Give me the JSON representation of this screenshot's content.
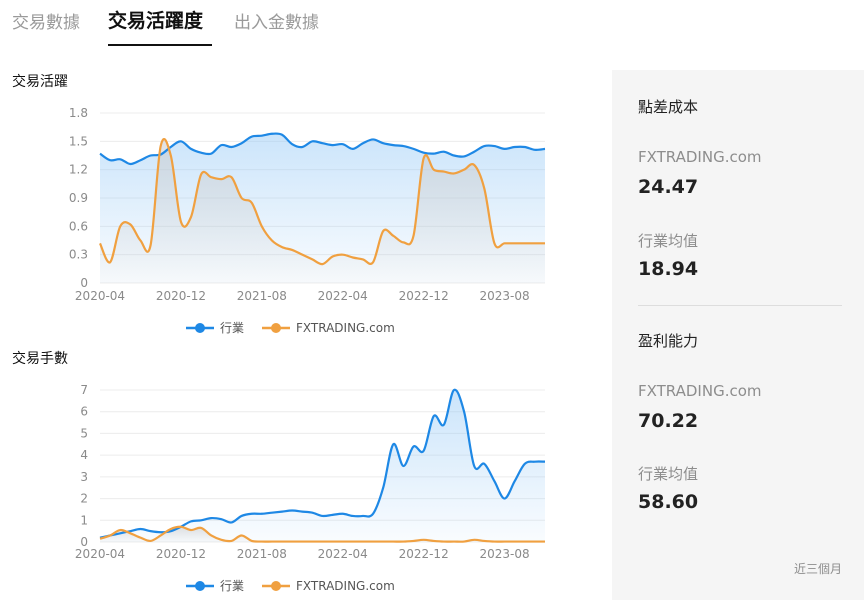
{
  "tabs": [
    {
      "label": "交易數據",
      "active": false
    },
    {
      "label": "交易活躍度",
      "active": true
    },
    {
      "label": "出入金數據",
      "active": false
    }
  ],
  "charts": {
    "activity": {
      "title": "交易活躍"
    },
    "volume": {
      "title": "交易手數"
    }
  },
  "chart_data": [
    {
      "type": "area",
      "title": "交易活躍",
      "xlabel": "",
      "ylabel": "",
      "ylim": [
        0,
        1.8
      ],
      "yticks": [
        "0",
        "0.3",
        "0.6",
        "0.9",
        "1.2",
        "1.5",
        "1.8"
      ],
      "xticks": [
        "2020-04",
        "2020-12",
        "2021-08",
        "2022-04",
        "2022-12",
        "2023-08"
      ],
      "legend": "bottom",
      "grid": true,
      "x": [
        "2020-04",
        "2020-05",
        "2020-06",
        "2020-07",
        "2020-08",
        "2020-09",
        "2020-10",
        "2020-11",
        "2020-12",
        "2021-01",
        "2021-02",
        "2021-03",
        "2021-04",
        "2021-05",
        "2021-06",
        "2021-07",
        "2021-08",
        "2021-09",
        "2021-10",
        "2021-11",
        "2021-12",
        "2022-01",
        "2022-02",
        "2022-03",
        "2022-04",
        "2022-05",
        "2022-06",
        "2022-07",
        "2022-08",
        "2022-09",
        "2022-10",
        "2022-11",
        "2022-12",
        "2023-01",
        "2023-02",
        "2023-03",
        "2023-04",
        "2023-05",
        "2023-06",
        "2023-07",
        "2023-08",
        "2023-09",
        "2023-10",
        "2023-11",
        "2023-12"
      ],
      "series": [
        {
          "name": "行業",
          "color": "#1e88e5",
          "values": [
            1.37,
            1.3,
            1.31,
            1.26,
            1.3,
            1.35,
            1.36,
            1.44,
            1.5,
            1.42,
            1.38,
            1.37,
            1.46,
            1.44,
            1.48,
            1.55,
            1.56,
            1.58,
            1.57,
            1.47,
            1.44,
            1.5,
            1.48,
            1.46,
            1.47,
            1.42,
            1.48,
            1.52,
            1.48,
            1.46,
            1.45,
            1.42,
            1.38,
            1.37,
            1.39,
            1.35,
            1.34,
            1.39,
            1.45,
            1.45,
            1.42,
            1.44,
            1.44,
            1.41,
            1.42
          ]
        },
        {
          "name": "FXTRADING.com",
          "color": "#f0a040",
          "values": [
            0.42,
            0.22,
            0.6,
            0.62,
            0.45,
            0.4,
            1.45,
            1.35,
            0.65,
            0.7,
            1.15,
            1.12,
            1.1,
            1.12,
            0.9,
            0.85,
            0.6,
            0.45,
            0.38,
            0.35,
            0.3,
            0.25,
            0.2,
            0.28,
            0.3,
            0.27,
            0.25,
            0.22,
            0.55,
            0.5,
            0.43,
            0.5,
            1.32,
            1.2,
            1.18,
            1.16,
            1.2,
            1.25,
            1.0,
            0.42,
            0.42,
            0.42,
            0.42,
            0.42,
            0.42
          ]
        }
      ]
    },
    {
      "type": "area",
      "title": "交易手數",
      "xlabel": "",
      "ylabel": "",
      "ylim": [
        0,
        7
      ],
      "yticks": [
        "0",
        "1",
        "2",
        "3",
        "4",
        "5",
        "6",
        "7"
      ],
      "xticks": [
        "2020-04",
        "2020-12",
        "2021-08",
        "2022-04",
        "2022-12",
        "2023-08"
      ],
      "legend": "bottom",
      "grid": true,
      "x": [
        "2020-04",
        "2020-05",
        "2020-06",
        "2020-07",
        "2020-08",
        "2020-09",
        "2020-10",
        "2020-11",
        "2020-12",
        "2021-01",
        "2021-02",
        "2021-03",
        "2021-04",
        "2021-05",
        "2021-06",
        "2021-07",
        "2021-08",
        "2021-09",
        "2021-10",
        "2021-11",
        "2021-12",
        "2022-01",
        "2022-02",
        "2022-03",
        "2022-04",
        "2022-05",
        "2022-06",
        "2022-07",
        "2022-08",
        "2022-09",
        "2022-10",
        "2022-11",
        "2022-12",
        "2023-01",
        "2023-02",
        "2023-03",
        "2023-04",
        "2023-05",
        "2023-06",
        "2023-07",
        "2023-08",
        "2023-09",
        "2023-10",
        "2023-11",
        "2023-12"
      ],
      "series": [
        {
          "name": "行業",
          "color": "#1e88e5",
          "values": [
            0.2,
            0.3,
            0.4,
            0.5,
            0.6,
            0.5,
            0.45,
            0.5,
            0.7,
            0.95,
            1.0,
            1.1,
            1.05,
            0.9,
            1.2,
            1.3,
            1.3,
            1.35,
            1.4,
            1.45,
            1.4,
            1.35,
            1.2,
            1.25,
            1.3,
            1.2,
            1.2,
            1.3,
            2.5,
            4.5,
            3.5,
            4.4,
            4.2,
            5.8,
            5.4,
            7.0,
            6.0,
            3.5,
            3.6,
            2.8,
            2.0,
            2.8,
            3.6,
            3.7,
            3.7
          ]
        },
        {
          "name": "FXTRADING.com",
          "color": "#f0a040",
          "values": [
            0.15,
            0.3,
            0.55,
            0.4,
            0.2,
            0.05,
            0.3,
            0.6,
            0.7,
            0.55,
            0.65,
            0.3,
            0.1,
            0.05,
            0.3,
            0.05,
            0.02,
            0.02,
            0.02,
            0.02,
            0.02,
            0.02,
            0.02,
            0.02,
            0.02,
            0.02,
            0.02,
            0.02,
            0.02,
            0.02,
            0.02,
            0.05,
            0.1,
            0.05,
            0.02,
            0.02,
            0.02,
            0.1,
            0.05,
            0.02,
            0.02,
            0.02,
            0.02,
            0.02,
            0.02
          ]
        }
      ]
    }
  ],
  "panel": {
    "spread_heading": "點差成本",
    "spread_broker_label": "FXTRADING.com",
    "spread_broker_value": "24.47",
    "spread_industry_label": "行業均值",
    "spread_industry_value": "18.94",
    "profit_heading": "盈利能力",
    "profit_broker_label": "FXTRADING.com",
    "profit_broker_value": "70.22",
    "profit_industry_label": "行業均值",
    "profit_industry_value": "58.60",
    "footnote": "近三個月"
  }
}
